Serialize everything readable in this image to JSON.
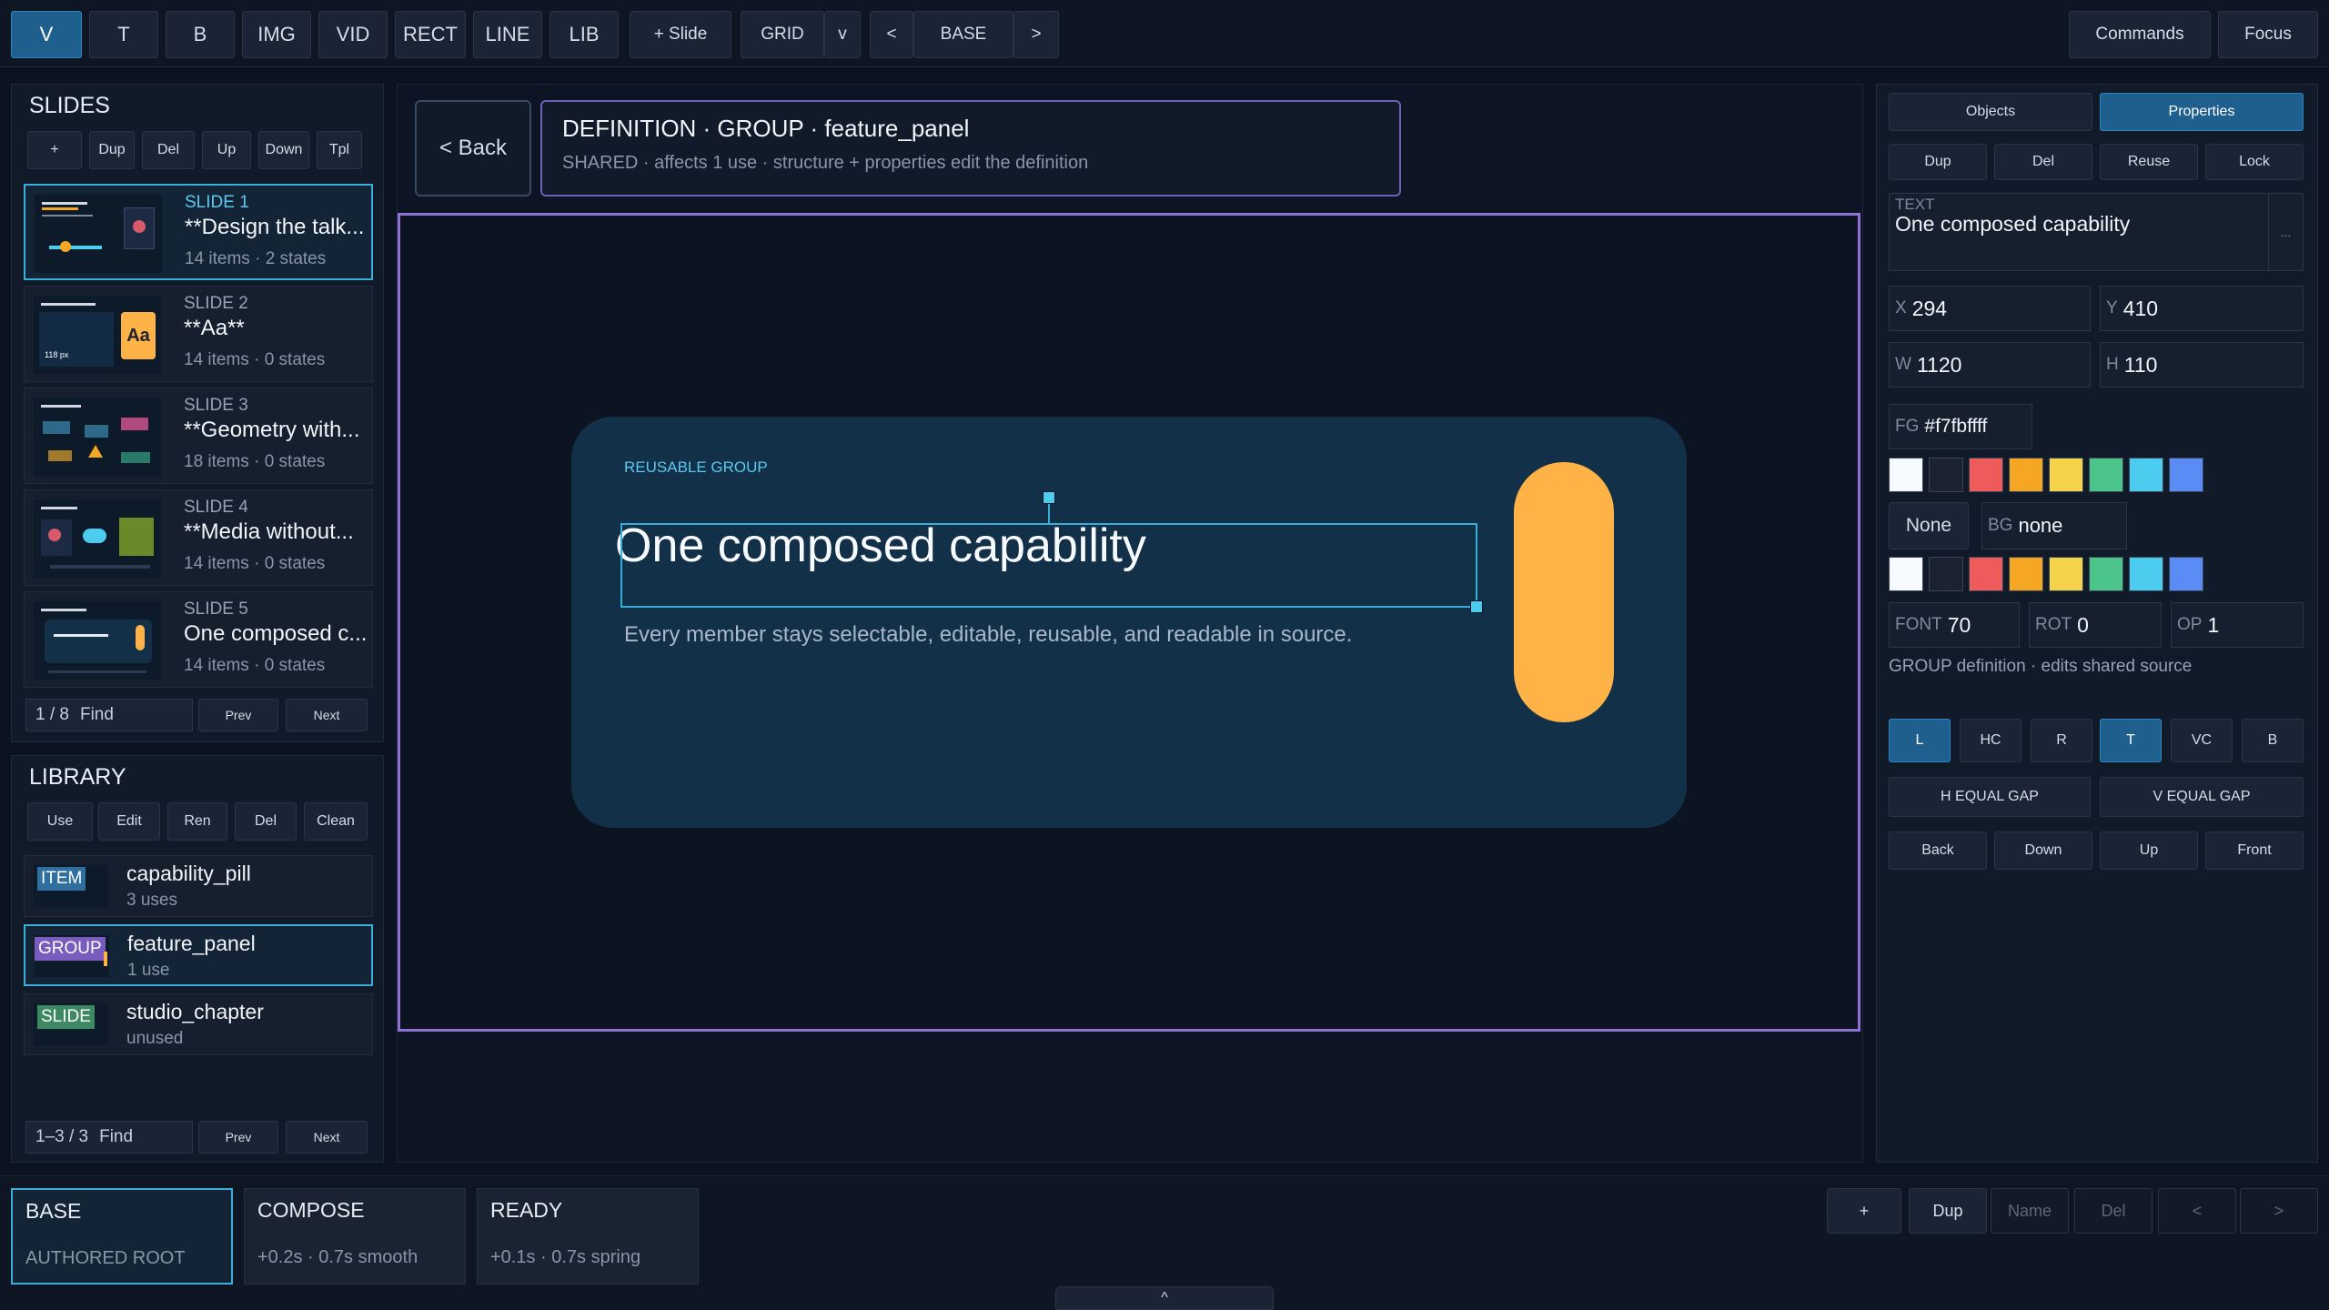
{
  "toolbar": {
    "tools": [
      "V",
      "T",
      "B",
      "IMG",
      "VID",
      "RECT",
      "LINE",
      "LIB"
    ],
    "add_slide": "+ Slide",
    "grid": "GRID",
    "grid_dropdown": "v",
    "prev": "<",
    "state": "BASE",
    "next": ">",
    "commands": "Commands",
    "focus": "Focus"
  },
  "slides_panel": {
    "title": "SLIDES",
    "actions": [
      "+",
      "Dup",
      "Del",
      "Up",
      "Down",
      "Tpl"
    ],
    "items": [
      {
        "num": "SLIDE 1",
        "title": "**Design the talk...",
        "meta": "14 items · 2 states"
      },
      {
        "num": "SLIDE 2",
        "title": "**Aa**",
        "meta": "14 items · 0 states"
      },
      {
        "num": "SLIDE 3",
        "title": "**Geometry with...",
        "meta": "18 items · 0 states"
      },
      {
        "num": "SLIDE 4",
        "title": "**Media without...",
        "meta": "14 items · 0 states"
      },
      {
        "num": "SLIDE 5",
        "title": "One composed c...",
        "meta": "14 items · 0 states"
      }
    ],
    "find_value": "1 / 8",
    "find_placeholder": "Find",
    "prev": "Prev",
    "next": "Next",
    "thumb_aa": "Aa",
    "thumb_px": "118 px"
  },
  "library_panel": {
    "title": "LIBRARY",
    "actions": [
      "Use",
      "Edit",
      "Ren",
      "Del",
      "Clean"
    ],
    "items": [
      {
        "tag": "ITEM",
        "tag_color": "#2e6fa0",
        "name": "capability_pill",
        "meta": "3 uses"
      },
      {
        "tag": "GROUP",
        "tag_color": "#7a5cbf",
        "name": "feature_panel",
        "meta": "1 use"
      },
      {
        "tag": "SLIDE",
        "tag_color": "#3d8a62",
        "name": "studio_chapter",
        "meta": "unused"
      }
    ],
    "find_value": "1–3 / 3",
    "find_placeholder": "Find",
    "prev": "Prev",
    "next": "Next"
  },
  "editor": {
    "back": "< Back",
    "definition_title": "DEFINITION · GROUP · feature_panel",
    "definition_sub": "SHARED · affects 1 use · structure + properties edit the definition",
    "panel_label": "REUSABLE GROUP",
    "panel_heading": "One composed capability",
    "panel_body": "Every member stays selectable, editable, reusable, and readable in source."
  },
  "properties": {
    "tabs": [
      "Objects",
      "Properties"
    ],
    "actions": [
      "Dup",
      "Del",
      "Reuse",
      "Lock"
    ],
    "text_label": "TEXT",
    "text_value": "One composed capability",
    "text_more": "...",
    "x": "294",
    "y": "410",
    "w": "1120",
    "h": "110",
    "fg_label": "FG",
    "fg": "#f7fbffff",
    "none": "None",
    "bg_label": "BG",
    "bg": "none",
    "swatches": [
      "#f7fbff",
      "#1b2230",
      "#ef5a5a",
      "#f5a623",
      "#f4d24a",
      "#4cc58a",
      "#4ccdf0",
      "#5b8cf5"
    ],
    "font_label": "FONT",
    "font": "70",
    "rot_label": "ROT",
    "rot": "0",
    "op_label": "OP",
    "op": "1",
    "group_note": "GROUP definition · edits shared source",
    "align": [
      "L",
      "HC",
      "R",
      "T",
      "VC",
      "B"
    ],
    "h_gap": "H EQUAL GAP",
    "v_gap": "V EQUAL GAP",
    "order": [
      "Back",
      "Down",
      "Up",
      "Front"
    ]
  },
  "states": {
    "items": [
      {
        "name": "BASE",
        "meta": "AUTHORED ROOT"
      },
      {
        "name": "COMPOSE",
        "meta": "+0.2s · 0.7s smooth"
      },
      {
        "name": "READY",
        "meta": "+0.1s · 0.7s spring"
      }
    ],
    "actions": [
      "+",
      "Dup",
      "Name",
      "Del",
      "<",
      ">"
    ],
    "expand": "^"
  },
  "colors": {
    "accent": "#3aaed8",
    "selection": "#8f72d4",
    "pill": "#ffb347"
  }
}
